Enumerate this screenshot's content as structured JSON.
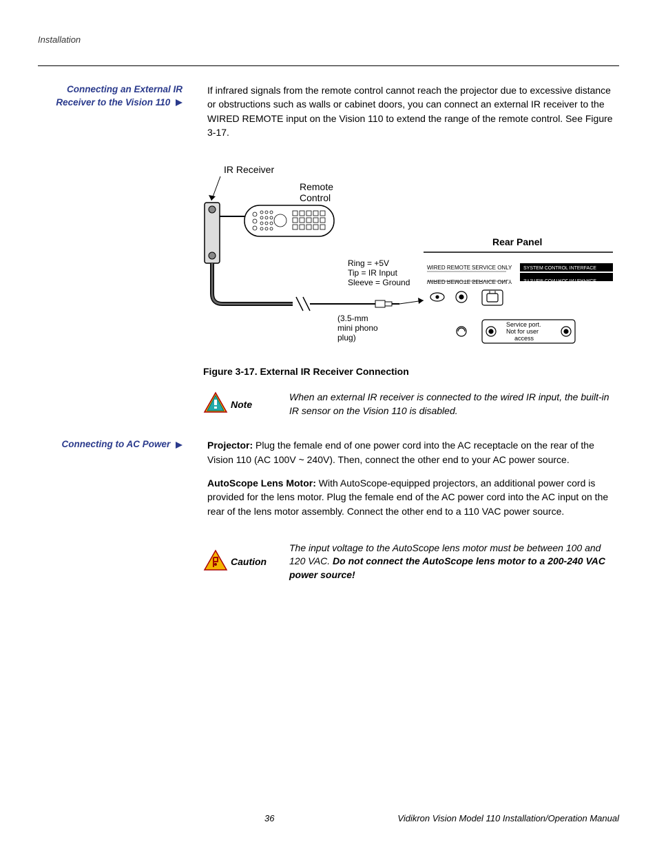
{
  "header": {
    "section": "Installation"
  },
  "sections": {
    "ir": {
      "heading": "Connecting an External IR Receiver to the Vision 110",
      "body": "If infrared signals from the remote control cannot reach the projector due to excessive distance or obstructions such as walls or cabinet doors, you can connect an external IR receiver to the WIRED REMOTE input on the Vision 110 to extend the range of the remote control. See Figure 3-17."
    },
    "power": {
      "heading": "Connecting to AC Power",
      "p1_label": "Projector:",
      "p1_text": " Plug the female end of one power cord into the AC receptacle on the rear of the Vision 110 (AC 100V ~ 240V). Then, connect the other end to your AC power source.",
      "p2_label": "AutoScope Lens Motor:",
      "p2_text": " With AutoScope-equipped projectors, an additional power cord is provided for the lens motor. Plug the female end of the AC power cord into the AC input on the rear of the lens motor assembly. Connect the other end to a 110 VAC power source."
    }
  },
  "figure": {
    "caption": "Figure 3-17. External IR Receiver Connection",
    "labels": {
      "ir_receiver": "IR Receiver",
      "remote_control_1": "Remote",
      "remote_control_2": "Control",
      "ring": "Ring = +5V",
      "tip": "Tip = IR Input",
      "sleeve": "Sleeve = Ground",
      "plug1": "(3.5-mm",
      "plug2": "mini phono",
      "plug3": "plug)",
      "rear_panel": "Rear Panel",
      "wired_remote": "WIRED REMOTE",
      "service_only": "SERVICE ONLY",
      "wired_remote_inv": "WIRED REMOTE",
      "service_only_inv": "SERVICE ONLY",
      "sys_ctrl": "SYSTEM CONTROL INTERFACE",
      "svc_port1": "Service port.",
      "svc_port2": "Not for user",
      "svc_port3": "access"
    }
  },
  "note": {
    "label": "Note",
    "text": "When an external IR receiver is connected to the wired IR input, the built-in IR sensor on the Vision 110 is disabled."
  },
  "caution": {
    "label": "Caution",
    "text1": "The input voltage to the AutoScope lens motor must be between 100 and 120 VAC. ",
    "text2": "Do not connect the AutoScope lens motor to a 200-240 VAC power source!"
  },
  "footer": {
    "page": "36",
    "title": "Vidikron Vision Model 110 Installation/Operation Manual"
  }
}
